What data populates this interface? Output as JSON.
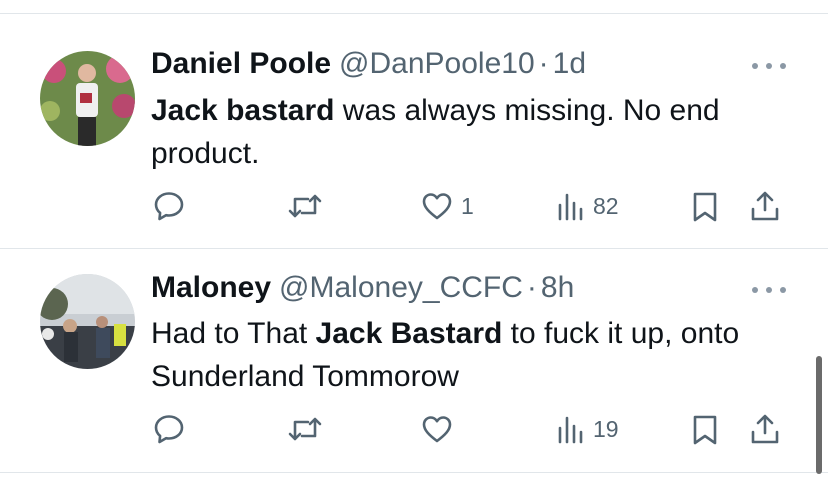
{
  "tweets": [
    {
      "name": "Daniel Poole",
      "handle": "@DanPoole10",
      "sep": "·",
      "time": "1d",
      "text_bold": "Jack bastard",
      "text_after": " was always missing. No end product.",
      "likes": "1",
      "views": "82"
    },
    {
      "name": "Maloney",
      "handle": "@Maloney_CCFC",
      "sep": "·",
      "time": "8h",
      "text_before": "Had to That ",
      "text_bold": "Jack Bastard",
      "text_after": " to fuck it up, onto Sunderland Tommorow",
      "likes": "",
      "views": "19"
    }
  ],
  "icons": {
    "reply": "reply-icon",
    "retweet": "retweet-icon",
    "like": "heart-icon",
    "views": "views-icon",
    "bookmark": "bookmark-icon",
    "share": "share-icon",
    "more": "more-icon"
  },
  "colors": {
    "secondary_text": "#536471",
    "divider": "#e1e6ea"
  }
}
